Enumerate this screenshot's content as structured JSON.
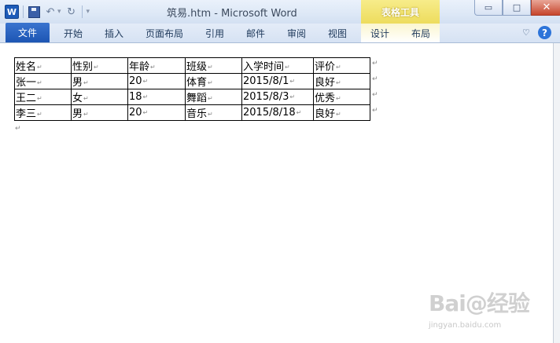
{
  "app": {
    "title": "筑易.htm - Microsoft Word",
    "icon_letter": "W"
  },
  "quick_access": {
    "icons": [
      "word-app-icon",
      "save-icon",
      "undo-icon",
      "redo-icon",
      "customize-dropdown-icon"
    ]
  },
  "context_tab": {
    "label": "表格工具"
  },
  "window_controls": {
    "minimize": "▭",
    "maximize": "□",
    "close": "✕"
  },
  "ribbon": {
    "file_tab": "文件",
    "tabs": [
      "开始",
      "插入",
      "页面布局",
      "引用",
      "邮件",
      "审阅",
      "视图"
    ],
    "context_tabs": [
      "设计",
      "布局"
    ],
    "help": "?",
    "collapse_icon": "♡"
  },
  "table": {
    "headers": [
      "姓名",
      "性别",
      "年龄",
      "班级",
      "入学时间",
      "评价"
    ],
    "rows": [
      [
        "张一",
        "男",
        "20",
        "体育",
        "2015/8/1",
        "良好"
      ],
      [
        "王二",
        "女",
        "18",
        "舞蹈",
        "2015/8/3",
        "优秀"
      ],
      [
        "李三",
        "男",
        "20",
        "音乐",
        "2015/8/18",
        "良好"
      ]
    ],
    "paragraph_mark": "↵"
  },
  "watermark": {
    "logo": "Bai@经验",
    "url": "jingyan.baidu.com"
  }
}
